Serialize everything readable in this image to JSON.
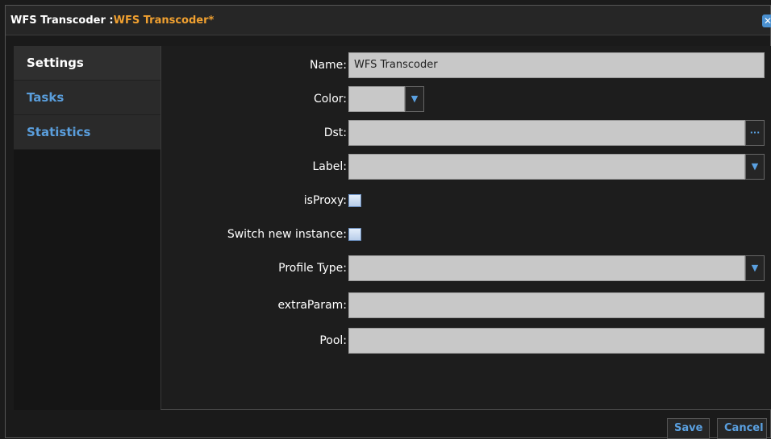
{
  "window": {
    "title_prefix": "WFS Transcoder : ",
    "title_highlight": "WFS Transcoder*",
    "close_glyph": "✕"
  },
  "sidebar": {
    "items": [
      {
        "label": "Settings",
        "active": true
      },
      {
        "label": "Tasks",
        "active": false
      },
      {
        "label": "Statistics",
        "active": false
      }
    ]
  },
  "form": {
    "name": {
      "label": "Name:",
      "value": "WFS Transcoder"
    },
    "color": {
      "label": "Color:",
      "value": ""
    },
    "dst": {
      "label": "Dst:",
      "value": "",
      "browse_glyph": "···"
    },
    "label": {
      "label": "Label:",
      "value": ""
    },
    "isproxy": {
      "label": "isProxy:",
      "checked": false
    },
    "switch_new_instance": {
      "label": "Switch new instance:",
      "checked": false
    },
    "profile_type": {
      "label": "Profile Type:",
      "value": ""
    },
    "extra_param": {
      "label": "extraParam:",
      "value": ""
    },
    "pool": {
      "label": "Pool:",
      "value": ""
    },
    "dropdown_glyph": "▼"
  },
  "footer": {
    "save_label": "Save",
    "cancel_label": "Cancel"
  },
  "colors": {
    "accent_blue": "#5aa0e0",
    "title_orange": "#f0a030",
    "field_bg": "#c8c8c8"
  }
}
